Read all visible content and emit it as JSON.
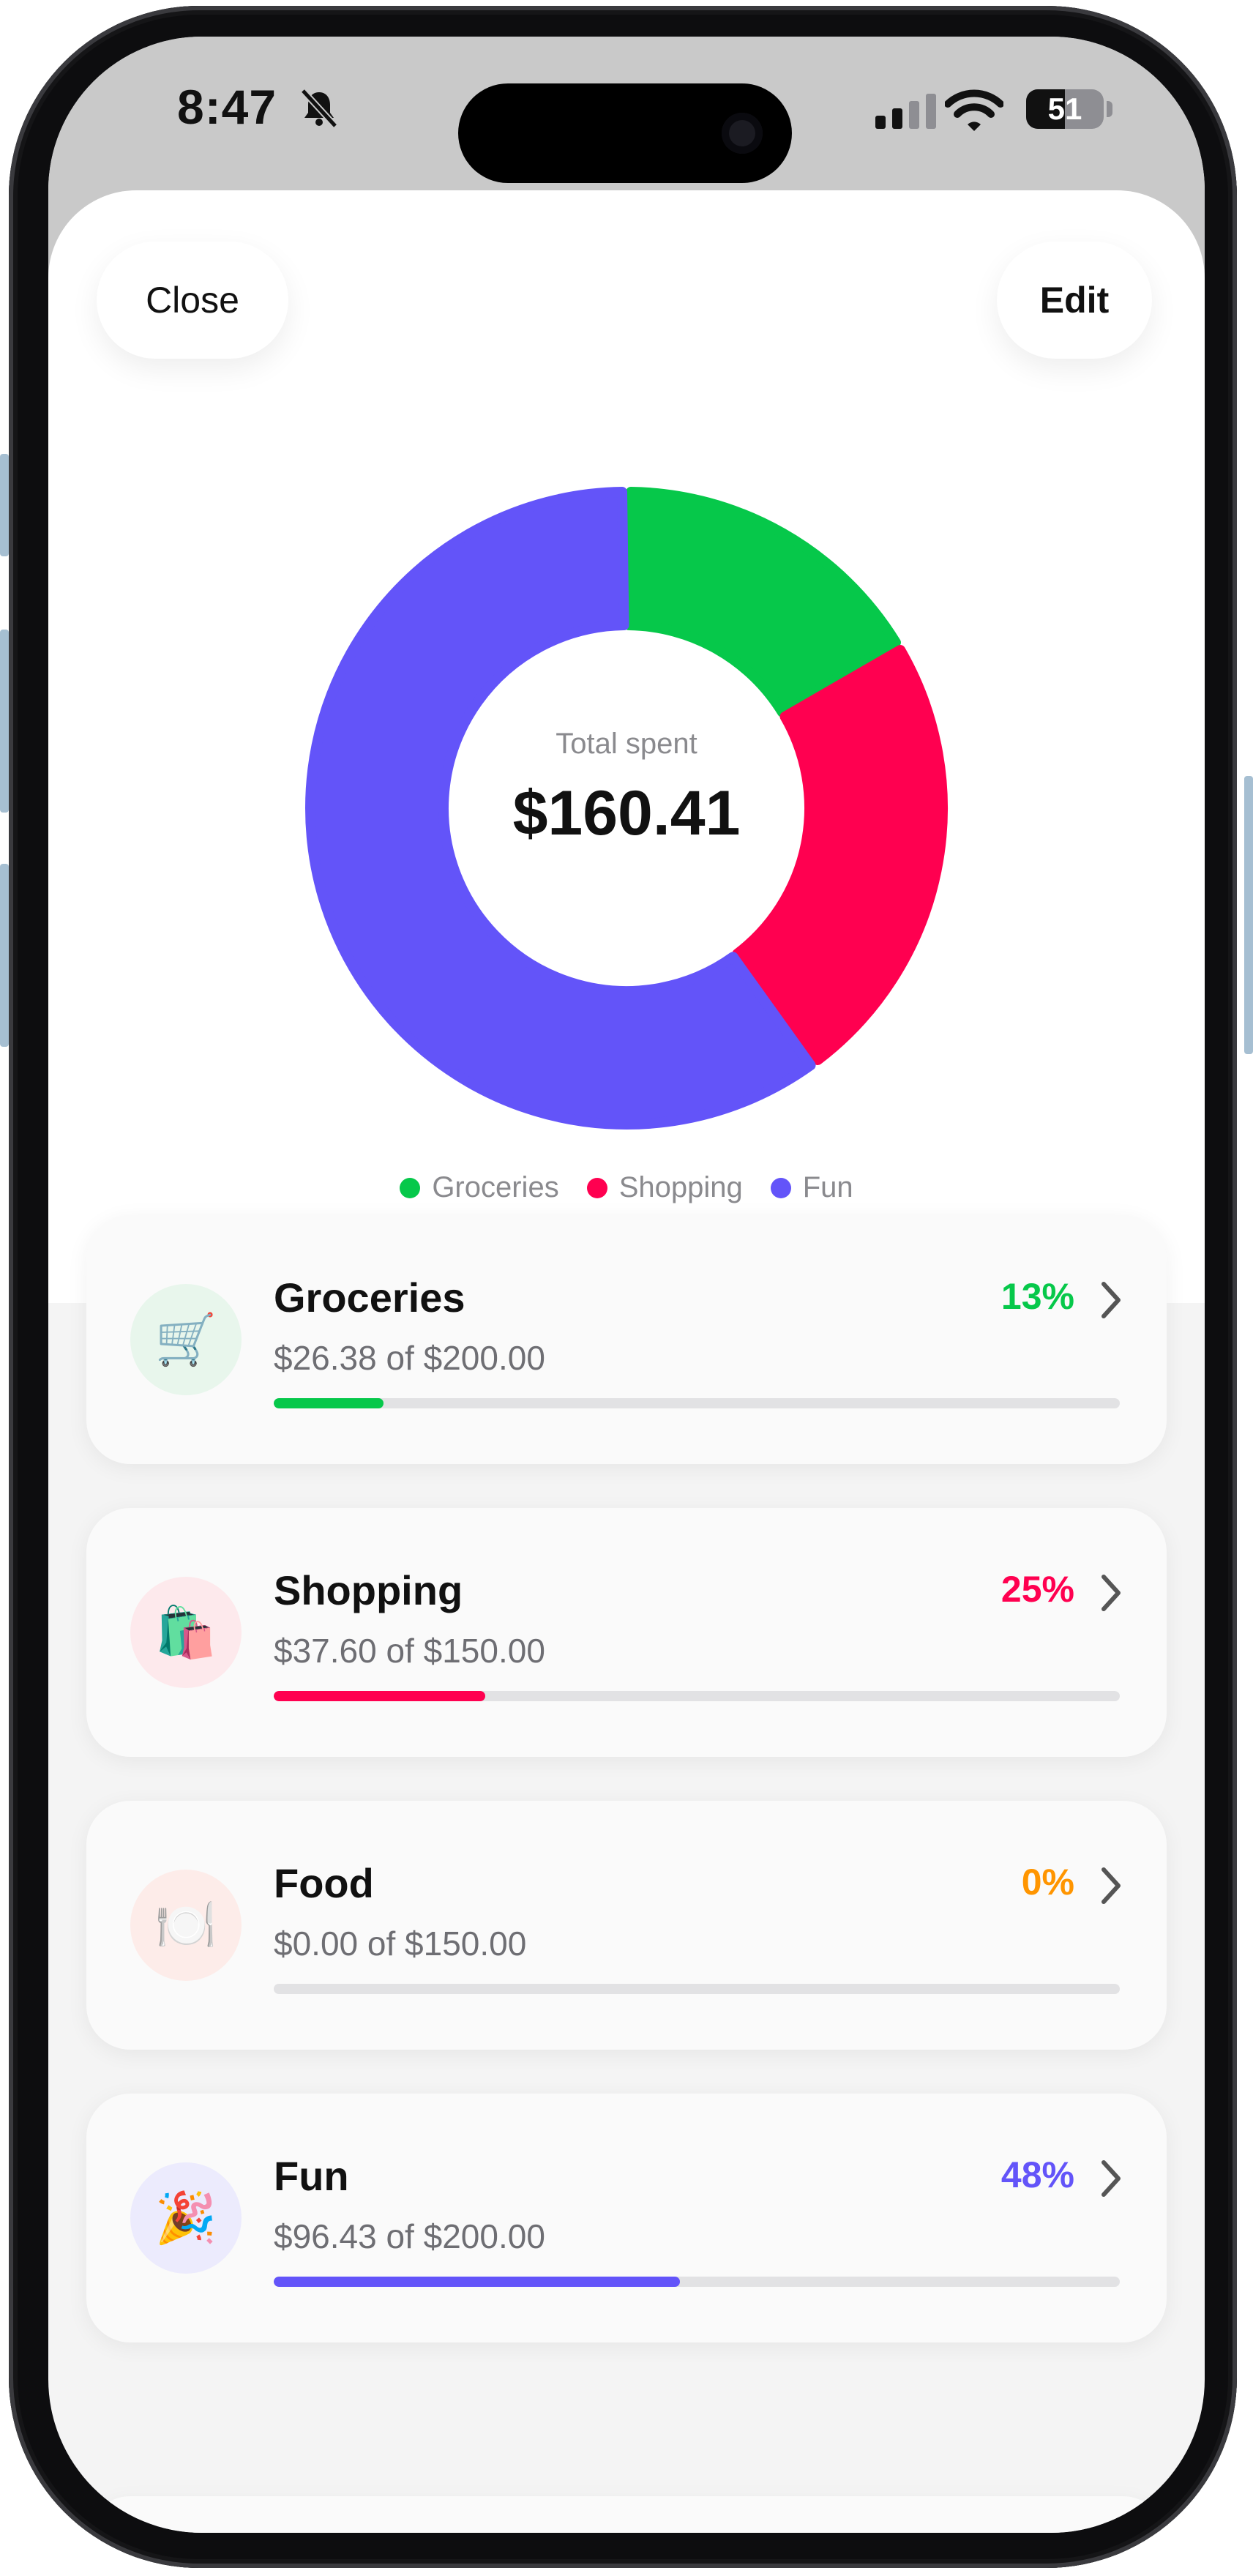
{
  "status_bar": {
    "time": "8:47",
    "battery": "51"
  },
  "header": {
    "close_label": "Close",
    "edit_label": "Edit"
  },
  "summary": {
    "total_label": "Total spent",
    "total_value": "$160.41"
  },
  "colors": {
    "groceries": "#06c84a",
    "shopping": "#ff0050",
    "food": "#ff9500",
    "fun": "#6354f9",
    "track": "#e2e2e4"
  },
  "chart_data": {
    "type": "pie",
    "style": "donut",
    "categories": [
      "Groceries",
      "Shopping",
      "Fun"
    ],
    "values": [
      26.38,
      37.6,
      96.43
    ],
    "colors": [
      "#06c84a",
      "#ff0050",
      "#6354f9"
    ],
    "legend": "bottom"
  },
  "legend": [
    {
      "label": "Groceries",
      "color": "#06c84a"
    },
    {
      "label": "Shopping",
      "color": "#ff0050"
    },
    {
      "label": "Fun",
      "color": "#6354f9"
    }
  ],
  "categories": [
    {
      "name": "Groceries",
      "amount": "$26.38 of $200.00",
      "percent": "13%",
      "progress": 0.13,
      "color": "#06c84a",
      "icon": "🛒",
      "icon_name": "shopping-cart-icon",
      "icon_bg": "#e8f6ec"
    },
    {
      "name": "Shopping",
      "amount": "$37.60 of $150.00",
      "percent": "25%",
      "progress": 0.25,
      "color": "#ff0050",
      "icon": "🛍️",
      "icon_name": "shopping-bags-icon",
      "icon_bg": "#fde9ec"
    },
    {
      "name": "Food",
      "amount": "$0.00 of $150.00",
      "percent": "0%",
      "progress": 0.0,
      "color": "#ff9500",
      "icon": "🍽️",
      "icon_name": "plate-cutlery-icon",
      "icon_bg": "#fdece9"
    },
    {
      "name": "Fun",
      "amount": "$96.43 of $200.00",
      "percent": "48%",
      "progress": 0.48,
      "color": "#6354f9",
      "icon": "🎉",
      "icon_name": "party-popper-icon",
      "icon_bg": "#ecebfd"
    }
  ]
}
